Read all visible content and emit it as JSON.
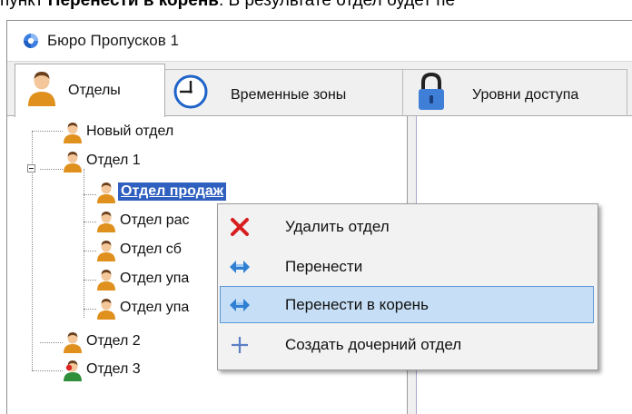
{
  "doc": {
    "prefix": "пункт ",
    "bold": "Перенести в корень",
    "suffix": ". В результате отдел будет пе"
  },
  "window": {
    "title": "Бюро Пропусков 1"
  },
  "tabs": [
    {
      "label": "Отделы",
      "icon": "person-icon",
      "active": true
    },
    {
      "label": "Временные зоны",
      "icon": "clock-icon",
      "active": false
    },
    {
      "label": "Уровни доступа",
      "icon": "lock-icon",
      "active": false
    }
  ],
  "tree": {
    "items": [
      {
        "label": "Новый отдел"
      },
      {
        "label": "Отдел 1",
        "expanded": true
      },
      {
        "label": "Отдел продаж",
        "selected": true
      },
      {
        "label": "Отдел рас"
      },
      {
        "label": "Отдел сб"
      },
      {
        "label": "Отдел упа"
      },
      {
        "label": "Отдел упа"
      },
      {
        "label": "Отдел 2"
      },
      {
        "label": "Отдел 3"
      }
    ]
  },
  "context_menu": {
    "items": [
      {
        "label": "Удалить отдел",
        "icon": "delete-x-icon"
      },
      {
        "label": "Перенести",
        "icon": "move-arrows-icon"
      },
      {
        "label": "Перенести в корень",
        "icon": "move-arrows-icon",
        "highlighted": true
      },
      {
        "label": "Создать дочерний отдел",
        "icon": "plus-icon"
      }
    ]
  },
  "colors": {
    "selection": "#2f5fbf",
    "menu_highlight": "#c7dff6",
    "menu_highlight_border": "#5b98d6",
    "delete_red": "#d81e1e",
    "arrow_blue": "#2f7fd3",
    "person_orange": "#e0901d"
  }
}
